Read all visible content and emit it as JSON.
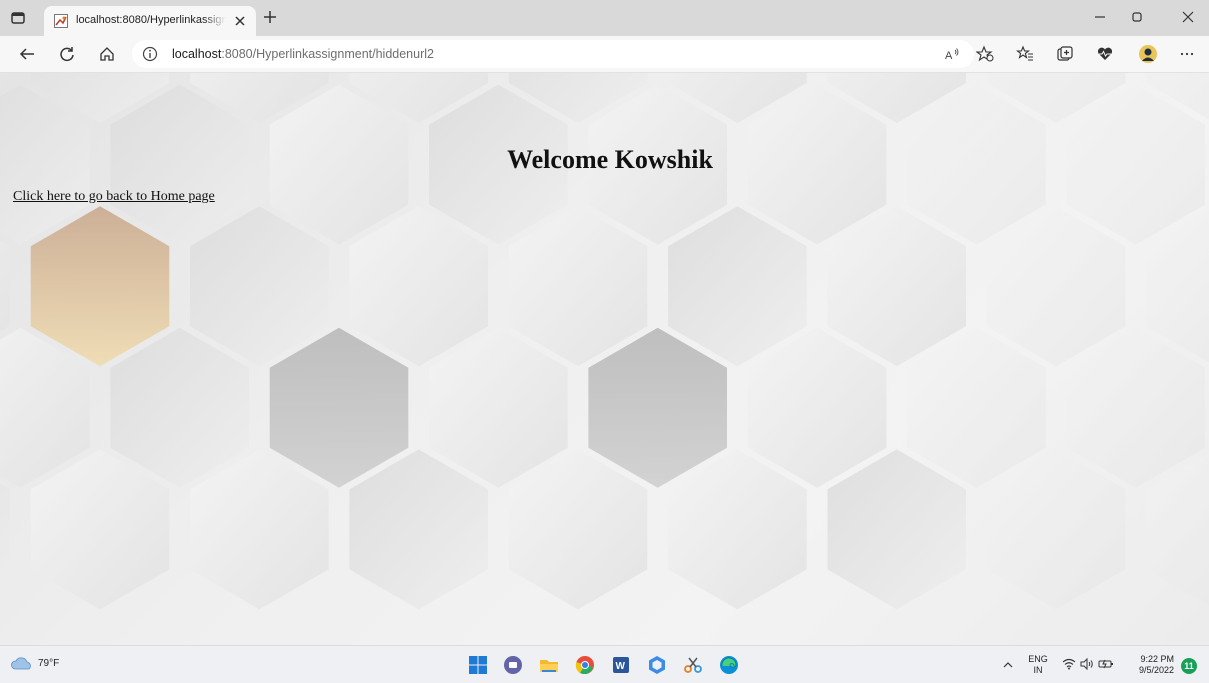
{
  "browser": {
    "tab_title": "localhost:8080/Hyperlinkassignm",
    "url_host": "localhost",
    "url_rest": ":8080/Hyperlinkassignment/hiddenurl2"
  },
  "page": {
    "heading": "Welcome Kowshik",
    "home_link": "Click here to go back to Home page"
  },
  "taskbar": {
    "weather_temp": "79°F",
    "language": "ENG",
    "region": "IN",
    "time": "9:22 PM",
    "date": "9/5/2022",
    "notification_count": "11",
    "apps": [
      "start",
      "teams",
      "file-explorer",
      "chrome",
      "word",
      "office",
      "snipping-tool",
      "edge"
    ]
  },
  "colors": {
    "accent_hex": "#d6b48f",
    "badge": "#18a058"
  }
}
